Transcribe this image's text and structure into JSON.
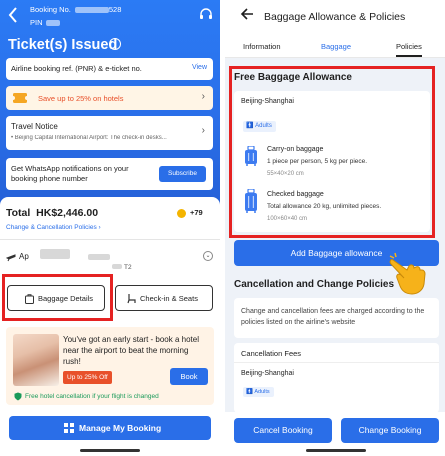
{
  "left": {
    "header": {
      "booking_label": "Booking No.",
      "booking_suffix": "528",
      "pin_label": "PIN",
      "title": "Ticket(s) Issued"
    },
    "pnr_card": {
      "label": "Airline booking ref. (PNR) & e-ticket no.",
      "action": "View"
    },
    "promo": {
      "label": "Save up to 25% on hotels"
    },
    "travel_notice": {
      "title": "Travel Notice",
      "text": "• Beijing Capital International Airport: The check-in desks..."
    },
    "whatsapp": {
      "text": "Get WhatsApp notifications on your booking phone number",
      "button": "Subscribe"
    },
    "total": {
      "label": "Total",
      "amount": "HK$2,446.00",
      "points": "+79"
    },
    "change_link": "Change & Cancellation Policies",
    "flight": {
      "prefix": "Ap",
      "terminal": "T2"
    },
    "buttons": {
      "baggage": "Baggage Details",
      "checkin": "Check-in & Seats"
    },
    "hotel": {
      "text": "You've got an early start - book a hotel near the airport to beat the morning rush!",
      "tag": "Up to 25% Off",
      "book": "Book",
      "free_cancel": "Free hotel cancellation if your flight is changed"
    },
    "manage": "Manage My Booking"
  },
  "right": {
    "title": "Baggage Allowance & Policies",
    "tabs": [
      "Information",
      "Baggage",
      "Policies"
    ],
    "free_title": "Free Baggage Allowance",
    "route": "Beijing-Shanghai",
    "adults": "Adults",
    "carry_on": {
      "label": "Carry-on baggage",
      "desc": "1 piece per person, 5 kg per piece.",
      "size": "55×40×20 cm"
    },
    "checked": {
      "label": "Checked baggage",
      "desc": "Total allowance 20 kg, unlimited pieces.",
      "size": "100×60×40 cm"
    },
    "add_button": "Add Baggage allowance",
    "cancel_title": "Cancellation and Change Policies",
    "cancel_text": "Change and cancellation fees are charged according to the policies listed on the airline's website",
    "fees_title": "Cancellation Fees",
    "fees_route": "Beijing-Shanghai",
    "fees_adults": "Adults",
    "cancel_button": "Cancel Booking",
    "change_button": "Change Booking"
  },
  "colors": {
    "accent": "#2a6ee8",
    "highlight": "#e52222",
    "promo_text": "#e8502a"
  }
}
